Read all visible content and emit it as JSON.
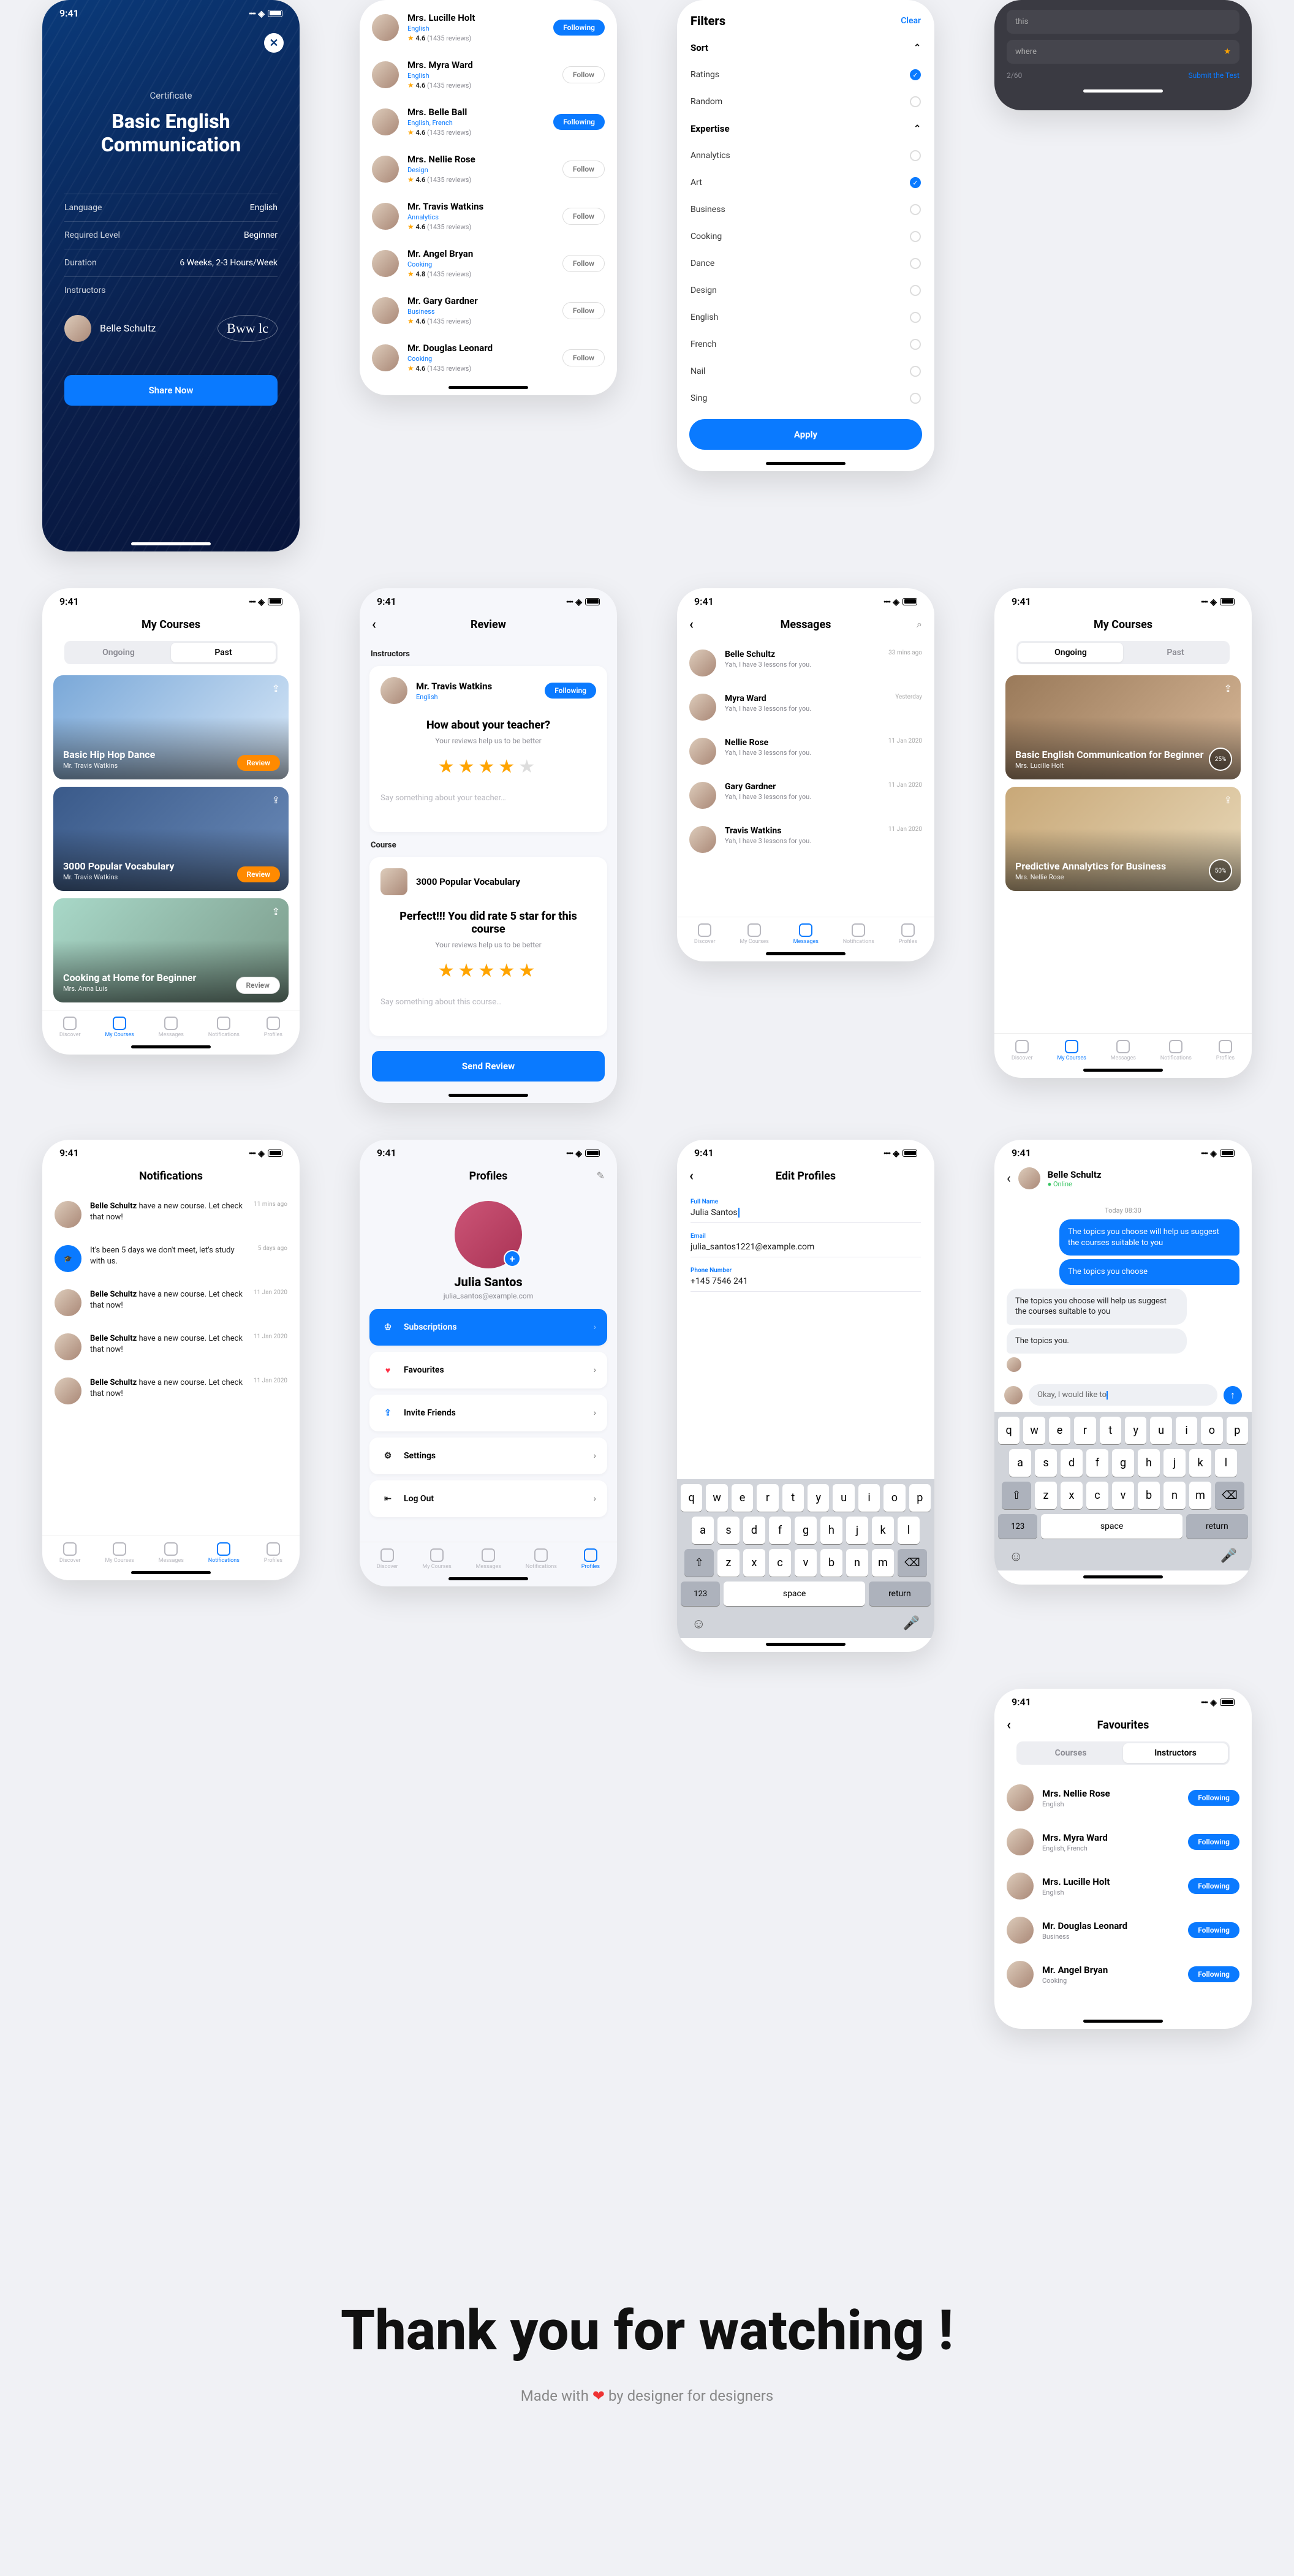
{
  "time": "9:41",
  "cert": {
    "sub": "Certificate",
    "title1": "Basic English",
    "title2": "Communication",
    "rows": [
      {
        "k": "Language",
        "v": "English"
      },
      {
        "k": "Required Level",
        "v": "Beginner"
      },
      {
        "k": "Duration",
        "v": "6 Weeks, 2-3 Hours/Week"
      }
    ],
    "instructors_label": "Instructors",
    "instructor": "Belle Schultz",
    "signature": "Bww lc",
    "share": "Share Now"
  },
  "quiz": {
    "opt1": "this",
    "opt2": "where",
    "counter": "2/60",
    "submit": "Submit the Test"
  },
  "people": [
    {
      "name": "Mrs. Lucille Holt",
      "subj": "English",
      "rating": "4.6",
      "reviews": "(1435 reviews)",
      "following": true
    },
    {
      "name": "Mrs. Myra Ward",
      "subj": "English",
      "rating": "4.6",
      "reviews": "(1435 reviews)",
      "following": false
    },
    {
      "name": "Mrs. Belle Ball",
      "subj": "English, French",
      "rating": "4.6",
      "reviews": "(1435 reviews)",
      "following": true
    },
    {
      "name": "Mrs. Nellie Rose",
      "subj": "Design",
      "rating": "4.6",
      "reviews": "(1435 reviews)",
      "following": false
    },
    {
      "name": "Mr. Travis Watkins",
      "subj": "Annalytics",
      "rating": "4.6",
      "reviews": "(1435 reviews)",
      "following": false
    },
    {
      "name": "Mr. Angel Bryan",
      "subj": "Cooking",
      "rating": "4.8",
      "reviews": "(1435 reviews)",
      "following": false
    },
    {
      "name": "Mr. Gary Gardner",
      "subj": "Business",
      "rating": "4.6",
      "reviews": "(1435 reviews)",
      "following": false
    },
    {
      "name": "Mr. Douglas Leonard",
      "subj": "Cooking",
      "rating": "4.6",
      "reviews": "(1435 reviews)",
      "following": false
    }
  ],
  "following_label": "Following",
  "follow_label": "Follow",
  "filters": {
    "title": "Filters",
    "clear": "Clear",
    "sort_label": "Sort",
    "sort": [
      {
        "name": "Ratings",
        "on": true
      },
      {
        "name": "Random",
        "on": false
      }
    ],
    "expertise_label": "Expertise",
    "expertise": [
      {
        "name": "Annalytics",
        "on": false
      },
      {
        "name": "Art",
        "on": true
      },
      {
        "name": "Business",
        "on": false
      },
      {
        "name": "Cooking",
        "on": false
      },
      {
        "name": "Dance",
        "on": false
      },
      {
        "name": "Design",
        "on": false
      },
      {
        "name": "English",
        "on": false
      },
      {
        "name": "French",
        "on": false
      },
      {
        "name": "Nail",
        "on": false
      },
      {
        "name": "Sing",
        "on": false
      }
    ],
    "apply": "Apply"
  },
  "mycourses": {
    "title": "My Courses",
    "ongoing": "Ongoing",
    "past": "Past",
    "review": "Review",
    "past_list": [
      {
        "t": "Basic Hip Hop Dance",
        "a": "Mr. Travis Watkins"
      },
      {
        "t": "3000 Popular Vocabulary",
        "a": "Mr. Travis Watkins"
      },
      {
        "t": "Cooking at Home for Beginner",
        "a": "Mrs. Anna Luis"
      }
    ],
    "ongoing_list": [
      {
        "t": "Basic English Communication for Beginner",
        "a": "Mrs. Lucille Holt",
        "pct": "25%"
      },
      {
        "t": "Predictive Annalytics for Business",
        "a": "Mrs. Nellie Rose",
        "pct": "50%"
      }
    ]
  },
  "notifications": {
    "title": "Notifications",
    "items": [
      {
        "who": "Belle Schultz",
        "txt": " have a new course. Let check that now!",
        "when": "11 mins ago"
      },
      {
        "who": "",
        "txt": "It's been 5 days we don't meet, let's study with us.",
        "when": "5 days ago",
        "icon": true
      },
      {
        "who": "Belle Schultz",
        "txt": " have a new course. Let check that now!",
        "when": "11 Jan 2020"
      },
      {
        "who": "Belle Schultz",
        "txt": " have a new course. Let check that now!",
        "when": "11 Jan 2020"
      },
      {
        "who": "Belle Schultz",
        "txt": " have a new course. Let check that now!",
        "when": "11 Jan 2020"
      }
    ]
  },
  "review": {
    "title": "Review",
    "instructors_label": "Instructors",
    "teacher_name": "Mr. Travis Watkins",
    "teacher_subj": "English",
    "q1": "How about your teacher?",
    "sub": "Your reviews help us to be better",
    "ph1": "Say something about your teacher…",
    "course_label": "Course",
    "course_name": "3000 Popular Vocabulary",
    "q2": "Perfect!!! You did rate 5 star for this course",
    "ph2": "Say something about this course…",
    "send": "Send Review"
  },
  "messages": {
    "title": "Messages",
    "items": [
      {
        "name": "Belle Schultz",
        "prev": "Yah, I have 3 lessons for you.",
        "when": "33 mins ago"
      },
      {
        "name": "Myra Ward",
        "prev": "Yah, I have 3 lessons for you.",
        "when": "Yesterday"
      },
      {
        "name": "Nellie Rose",
        "prev": "Yah, I have 3 lessons for you.",
        "when": "11 Jan 2020"
      },
      {
        "name": "Gary Gardner",
        "prev": "Yah, I have 3 lessons for you.",
        "when": "11 Jan 2020"
      },
      {
        "name": "Travis Watkins",
        "prev": "Yah, I have 3 lessons for you.",
        "when": "11 Jan 2020"
      }
    ]
  },
  "chat": {
    "name": "Belle Schultz",
    "status": "Online",
    "day": "Today 08:30",
    "msgs": [
      {
        "t": "The topics you choose will help us suggest the courses suitable to you",
        "sent": true
      },
      {
        "t": "The topics you choose",
        "sent": true
      },
      {
        "t": "The topics you choose will help us suggest the courses suitable to you",
        "sent": false
      },
      {
        "t": "The topics you.",
        "sent": false
      }
    ],
    "input": "Okay, I would like to"
  },
  "profile": {
    "title": "Profiles",
    "name": "Julia Santos",
    "email": "julia_santos@example.com",
    "menu": [
      {
        "label": "Subscriptions",
        "icon": "crown",
        "active": true
      },
      {
        "label": "Favourites",
        "icon": "heart",
        "color": "#ff3045"
      },
      {
        "label": "Invite Friends",
        "icon": "share",
        "color": "#0a7aff"
      },
      {
        "label": "Settings",
        "icon": "gear",
        "color": "#222"
      },
      {
        "label": "Log Out",
        "icon": "logout",
        "color": "#222"
      }
    ]
  },
  "edit": {
    "title": "Edit Profiles",
    "fields": [
      {
        "lbl": "Full Name",
        "val": "Julia Santos",
        "cursor": true
      },
      {
        "lbl": "Email",
        "val": "julia_santos1221@example.com"
      },
      {
        "lbl": "Phone Number",
        "val": "+145 7546 241"
      }
    ]
  },
  "fav": {
    "title": "Favourites",
    "courses": "Courses",
    "instructors": "Instructors",
    "list": [
      {
        "name": "Mrs. Nellie Rose",
        "sub": "English"
      },
      {
        "name": "Mrs. Myra Ward",
        "sub": "English, French"
      },
      {
        "name": "Mrs. Lucille Holt",
        "sub": "English"
      },
      {
        "name": "Mr. Douglas Leonard",
        "sub": "Business"
      },
      {
        "name": "Mr. Angel Bryan",
        "sub": "Cooking"
      }
    ]
  },
  "tabs": [
    "Discover",
    "My Courses",
    "Messages",
    "Notifications",
    "Profiles"
  ],
  "keyboard": {
    "r1": [
      "q",
      "w",
      "e",
      "r",
      "t",
      "y",
      "u",
      "i",
      "o",
      "p"
    ],
    "r2": [
      "a",
      "s",
      "d",
      "f",
      "g",
      "h",
      "j",
      "k",
      "l"
    ],
    "r3": [
      "z",
      "x",
      "c",
      "v",
      "b",
      "n",
      "m"
    ],
    "shift": "⇧",
    "bksp": "⌫",
    "num": "123",
    "space": "space",
    "ret": "return"
  },
  "footer": {
    "h": "Thank you for watching !",
    "p1": "Made with ",
    "heart": "❤",
    "p2": " by designer for designers"
  }
}
